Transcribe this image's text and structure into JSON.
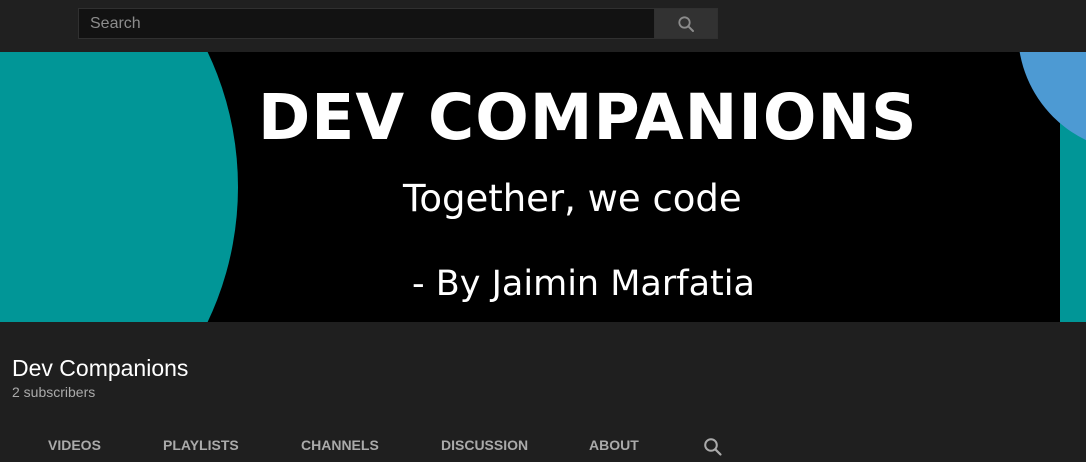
{
  "search": {
    "placeholder": "Search",
    "button_icon": "search-icon"
  },
  "banner": {
    "title": "DEV COMPANIONS",
    "tagline": "Together, we code",
    "author": "- By Jaimin Marfatia",
    "colors": {
      "background": "#000000",
      "accent_teal": "#019697",
      "accent_blue": "#4d9ad3"
    }
  },
  "channel": {
    "name": "Dev Companions",
    "subscribers": "2 subscribers"
  },
  "tabs": [
    {
      "label": "VIDEOS"
    },
    {
      "label": "PLAYLISTS"
    },
    {
      "label": "CHANNELS"
    },
    {
      "label": "DISCUSSION"
    },
    {
      "label": "ABOUT"
    }
  ],
  "tab_search_icon": "search-icon"
}
